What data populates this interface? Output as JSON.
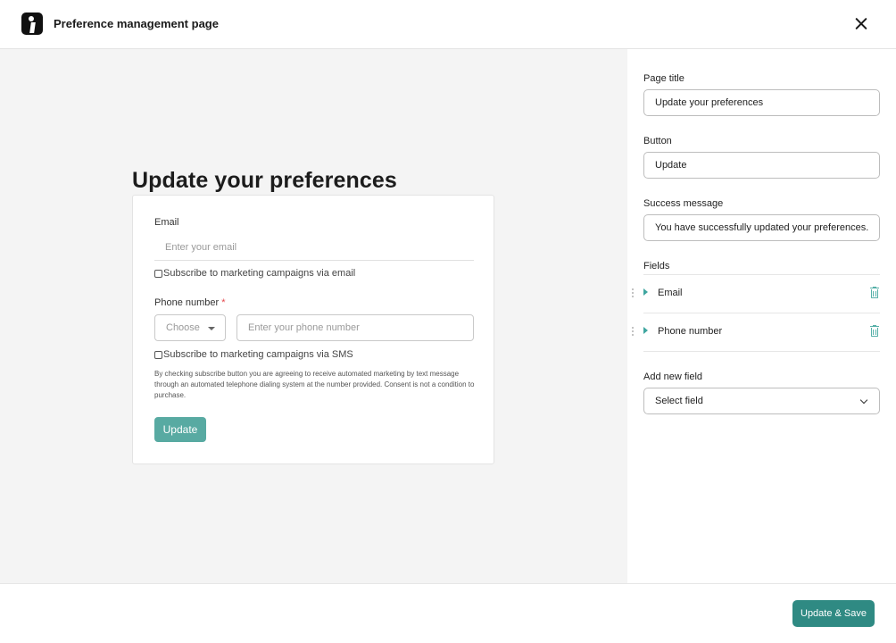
{
  "header": {
    "title": "Preference management page",
    "logo_icon": "brand-logo-icon",
    "close_icon": "close-icon"
  },
  "preview": {
    "page_title": "Update your preferences",
    "email_label": "Email",
    "email_placeholder": "Enter your email",
    "email_subscribe_label": "Subscribe to marketing campaigns via email",
    "phone_label": "Phone number",
    "phone_required_mark": "*",
    "country_select_value": "Choose",
    "phone_placeholder": "Enter your phone number",
    "sms_subscribe_label": "Subscribe to marketing campaigns via SMS",
    "consent_text": "By checking subscribe button you are agreeing to receive automated marketing by text message through an automated telephone dialing system at the number provided. Consent is not a condition to purchase.",
    "update_button": "Update"
  },
  "panel": {
    "page_title_label": "Page title",
    "page_title_value": "Update your preferences",
    "button_label": "Button",
    "button_value": "Update",
    "success_label": "Success message",
    "success_value": "You have successfully updated your preferences.",
    "fields_label": "Fields",
    "fields": [
      {
        "name": "Email"
      },
      {
        "name": "Phone number"
      }
    ],
    "add_field_label": "Add new field",
    "add_field_value": "Select field"
  },
  "footer": {
    "save_button": "Update & Save"
  },
  "colors": {
    "accent": "#58aaa2",
    "accent_dark": "#2f8a83",
    "required": "#e5484d"
  }
}
